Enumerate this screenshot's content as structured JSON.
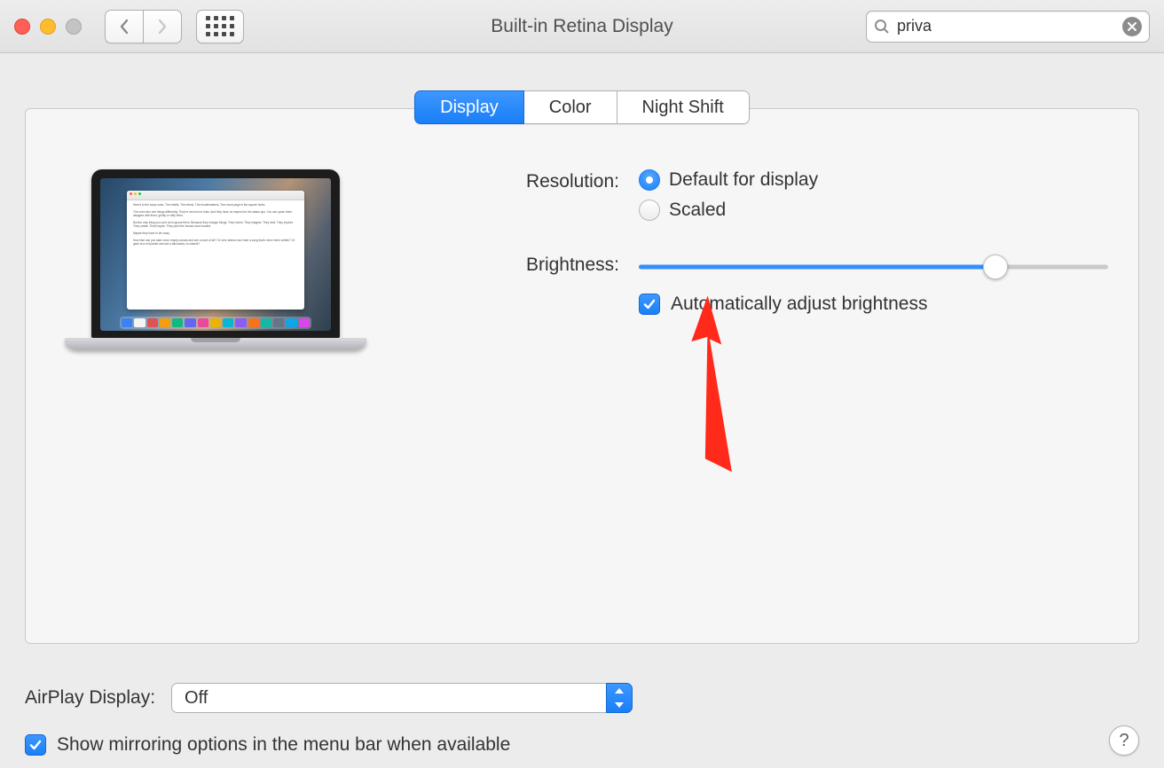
{
  "window": {
    "title": "Built-in Retina Display"
  },
  "search": {
    "value": "priva"
  },
  "tabs": [
    {
      "label": "Display",
      "active": true
    },
    {
      "label": "Color",
      "active": false
    },
    {
      "label": "Night Shift",
      "active": false
    }
  ],
  "form": {
    "resolution": {
      "label": "Resolution:",
      "options": [
        "Default for display",
        "Scaled"
      ],
      "selected": "Default for display"
    },
    "brightness": {
      "label": "Brightness:",
      "percent": 76,
      "auto_label": "Automatically adjust brightness",
      "auto_checked": true
    }
  },
  "airplay": {
    "label": "AirPlay Display:",
    "value": "Off"
  },
  "mirror": {
    "label": "Show mirroring options in the menu bar when available",
    "checked": true
  },
  "help_glyph": "?",
  "preview_text": [
    "Here's to the crazy ones. The misfits. The rebels. The troublemakers. The round pegs in the square holes.",
    "The ones who see things differently. They're not fond of rules. And they have no respect for the status quo. You can quote them, disagree with them, glorify or vilify them.",
    "But the only thing you can't do is ignore them. Because they change things. They invent. They imagine. They heal. They explore. They create. They inspire. They push the human race forward.",
    "Maybe they have to be crazy.",
    "How else can you stare at an empty canvas and see a work of art? Or sit in silence and hear a song that's never been written? Or gaze at a red planet and see a laboratory on wheels?"
  ]
}
